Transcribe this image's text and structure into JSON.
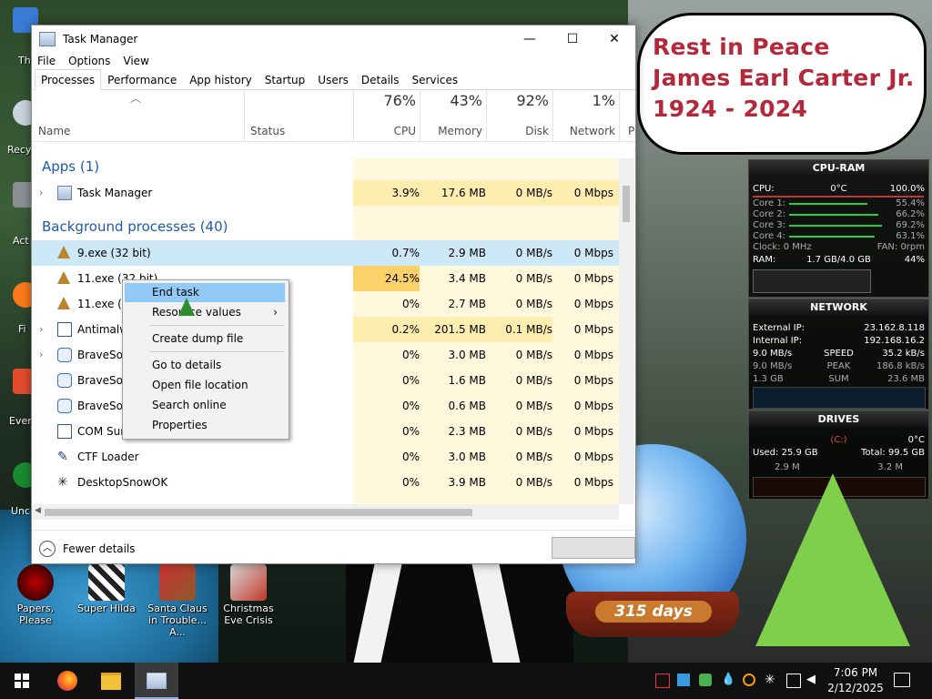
{
  "desktop": {
    "left_edge_labels": [
      "Th",
      "Recy",
      "Act",
      "Fi",
      "Ever",
      "Unc"
    ],
    "bottom_icons": [
      {
        "label": "Papers, Please",
        "icon": "papers-please-icon"
      },
      {
        "label": "Super Hilda",
        "icon": "super-hilda-icon"
      },
      {
        "label": "Santa Claus in Trouble... A...",
        "icon": "santa-claus-icon"
      },
      {
        "label": "Christmas Eve Crisis",
        "icon": "christmas-eve-icon"
      }
    ],
    "bubble_lines": [
      "Rest in Peace",
      "James Earl Carter Jr.",
      "1924 - 2024"
    ],
    "globe_days": "315 days"
  },
  "task_manager": {
    "title": "Task Manager",
    "controls": {
      "minimize": "—",
      "maximize": "☐",
      "close": "✕"
    },
    "menu": [
      "File",
      "Options",
      "View"
    ],
    "tabs": [
      "Processes",
      "Performance",
      "App history",
      "Startup",
      "Users",
      "Details",
      "Services"
    ],
    "active_tab": "Processes",
    "columns": {
      "name": "Name",
      "status": "Status",
      "cpu": {
        "pct": "76%",
        "label": "CPU"
      },
      "memory": {
        "pct": "43%",
        "label": "Memory"
      },
      "disk": {
        "pct": "92%",
        "label": "Disk"
      },
      "network": {
        "pct": "1%",
        "label": "Network"
      },
      "power_partial": "P"
    },
    "groups": {
      "apps": "Apps (1)",
      "background": "Background processes (40)"
    },
    "rows": [
      {
        "name": "Task Manager",
        "cpu": "3.9%",
        "mem": "17.6 MB",
        "disk": "0 MB/s",
        "net": "0 Mbps"
      },
      {
        "name": "9.exe (32 bit)",
        "cpu": "0.7%",
        "mem": "2.9 MB",
        "disk": "0 MB/s",
        "net": "0 Mbps"
      },
      {
        "name": "11.exe (32 bit)",
        "cpu": "24.5%",
        "mem": "3.4 MB",
        "disk": "0 MB/s",
        "net": "0 Mbps"
      },
      {
        "name": "11.exe (32",
        "cpu": "0%",
        "mem": "2.7 MB",
        "disk": "0 MB/s",
        "net": "0 Mbps"
      },
      {
        "name": "Antimalw",
        "cpu": "0.2%",
        "mem": "201.5 MB",
        "disk": "0.1 MB/s",
        "net": "0 Mbps"
      },
      {
        "name": "BraveSof",
        "cpu": "0%",
        "mem": "3.0 MB",
        "disk": "0 MB/s",
        "net": "0 Mbps"
      },
      {
        "name": "BraveSof",
        "cpu": "0%",
        "mem": "1.6 MB",
        "disk": "0 MB/s",
        "net": "0 Mbps"
      },
      {
        "name": "BraveSof",
        "cpu": "0%",
        "mem": "0.6 MB",
        "disk": "0 MB/s",
        "net": "0 Mbps"
      },
      {
        "name": "COM Sur",
        "cpu": "0%",
        "mem": "2.3 MB",
        "disk": "0 MB/s",
        "net": "0 Mbps"
      },
      {
        "name": "CTF Loader",
        "cpu": "0%",
        "mem": "3.0 MB",
        "disk": "0 MB/s",
        "net": "0 Mbps"
      },
      {
        "name": "DesktopSnowOK",
        "cpu": "0%",
        "mem": "3.9 MB",
        "disk": "0 MB/s",
        "net": "0 Mbps"
      }
    ],
    "fewer_details": "Fewer details",
    "context_menu": [
      "End task",
      "Resource values",
      "Create dump file",
      "Go to details",
      "Open file location",
      "Search online",
      "Properties"
    ]
  },
  "gadgets": {
    "cpu_ram": {
      "title": "CPU-RAM",
      "cpu_label": "CPU:",
      "cpu_temp": "0°C",
      "cpu_pct": "100.0%",
      "cores": [
        {
          "label": "Core 1:",
          "value": "55.4%"
        },
        {
          "label": "Core 2:",
          "value": "66.2%"
        },
        {
          "label": "Core 3:",
          "value": "69.2%"
        },
        {
          "label": "Core 4:",
          "value": "63.1%"
        }
      ],
      "clock": "Clock: 0 MHz",
      "fan": "FAN: 0rpm",
      "ram_label": "RAM:",
      "ram_value": "1.7 GB/4.0 GB",
      "ram_pct": "44%"
    },
    "network": {
      "title": "NETWORK",
      "external_label": "External IP:",
      "external_ip": "23.162.8.118",
      "internal_label": "Internal IP:",
      "internal_ip": "192.168.16.2",
      "speed_down": "9.0 MB/s",
      "speed_label": "SPEED",
      "speed_up": "35.2 kB/s",
      "peak_down": "9.0 MB/s",
      "peak_label": "PEAK",
      "peak_up": "186.8 kB/s",
      "sum_down": "1.3 GB",
      "sum_label": "SUM",
      "sum_up": "23.6 MB"
    },
    "drives": {
      "title": "DRIVES",
      "drive": "(C:)",
      "temp": "0°C",
      "used": "Used: 25.9 GB",
      "total": "Total: 99.5 GB",
      "read": "2.9 M",
      "write": "3.2 M"
    }
  },
  "taskbar": {
    "apps": [
      "start-icon",
      "firefox-icon",
      "file-explorer-icon",
      "task-manager-icon"
    ],
    "time": "7:06 PM",
    "date": "2/12/2025"
  },
  "colors": {
    "group_title": "#1e5aa8",
    "selection": "#cde8f7",
    "heat_light": "#fff8dc",
    "heat_mid": "#fdeeb0",
    "heat_high": "#fbd26a",
    "bubble_text": "#b1293a",
    "menu_hover": "#91c9f7"
  }
}
